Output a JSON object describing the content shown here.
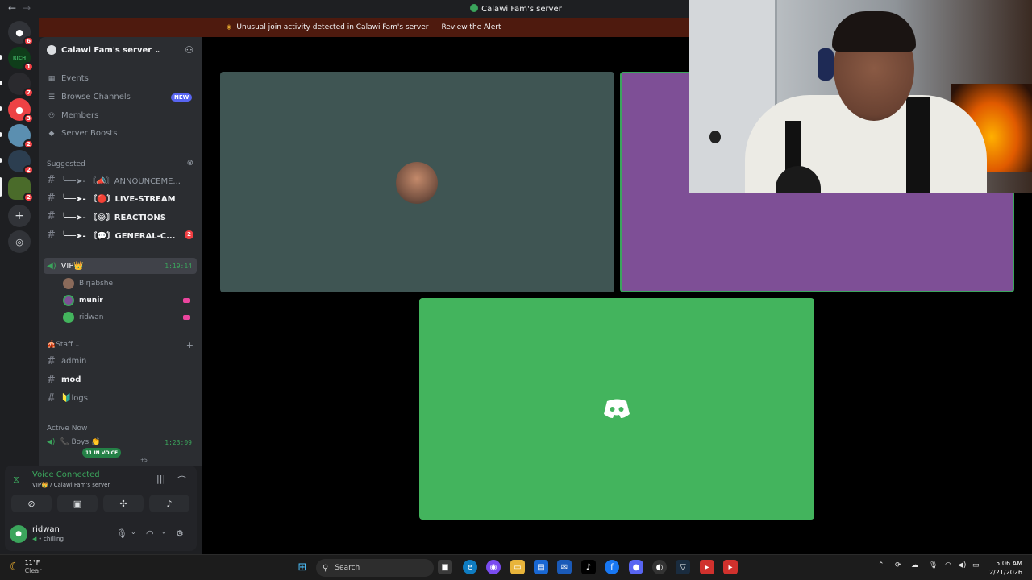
{
  "window": {
    "title": "Calawi Fam's server"
  },
  "alert": {
    "text": "Unusual join activity detected in Calawi Fam's server",
    "action": "Review the Alert"
  },
  "server_rail": {
    "badges": [
      "6",
      "1",
      "7",
      "3",
      "2",
      "2",
      "2"
    ]
  },
  "sidebar": {
    "server_name": "Calawi Fam's server",
    "menu": [
      {
        "label": "Events"
      },
      {
        "label": "Browse Channels",
        "badge": "NEW"
      },
      {
        "label": "Members"
      },
      {
        "label": "Server Boosts"
      }
    ],
    "suggested_label": "Suggested",
    "suggested": [
      {
        "name": "╰──➤‐ 〘📣〙ANNOUNCEME...",
        "unread": false
      },
      {
        "name": "╰──➤‐ 〘🔴〙LIVE-STREAM",
        "unread": true
      },
      {
        "name": "╰──➤‐ 〘😂〙REACTIONS",
        "unread": true
      },
      {
        "name": "╰──➤‐ 〘💬〙GENERAL-C...",
        "unread": true,
        "count": "2"
      }
    ],
    "voice_channel": {
      "name": "VIP👑",
      "timer": "1:19:14"
    },
    "voice_users": [
      {
        "name": "Birjabshe",
        "streaming": false
      },
      {
        "name": "munir",
        "streaming": true
      },
      {
        "name": "ridwan",
        "streaming": true
      }
    ],
    "category": "🎪Staff",
    "staff_channels": [
      {
        "name": "admin",
        "unread": false
      },
      {
        "name": "mod",
        "unread": true
      },
      {
        "name": "🔰logs",
        "unread": false
      }
    ],
    "active_now_label": "Active Now",
    "active_channel": {
      "name": "📞 Boys 👏",
      "timer": "1:23:09",
      "in_voice": "11 IN VOICE",
      "extra": "+5"
    }
  },
  "voice_panel": {
    "status": "Voice Connected",
    "location": "VIP👑 / Calawi Fam's server",
    "user_name": "ridwan",
    "user_status": "chilling"
  },
  "taskbar": {
    "temp": "11°F",
    "condition": "Clear",
    "search_placeholder": "Search",
    "time": "5:06 AM",
    "date": "2/21/2026"
  },
  "colors": {
    "tile1": "#3f5553",
    "tile2": "#7e4f96",
    "tile3": "#43b45d",
    "speaking_border": "#3ba55c",
    "alert_bg": "#4e1a0e"
  }
}
